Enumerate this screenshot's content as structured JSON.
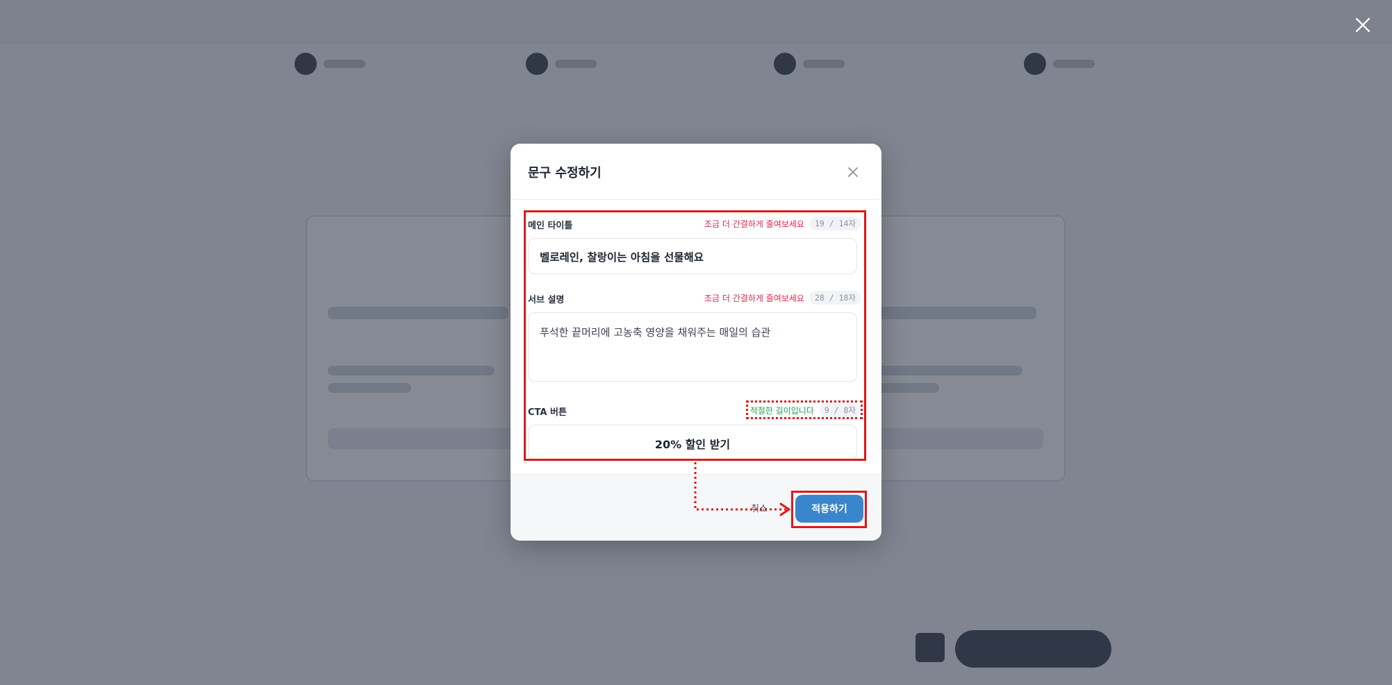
{
  "modal": {
    "title": "문구 수정하기",
    "fields": [
      {
        "label": "메인 타이틀",
        "hint": "조금 더 간결하게 줄여보세요",
        "counter": "19 / 14자",
        "value": "벨로레인, 찰랑이는 아침을 선물해요"
      },
      {
        "label": "서브 설명",
        "hint": "조금 더 간결하게 줄여보세요",
        "counter": "28 / 18자",
        "value": "푸석한 끝머리에 고농축 영양을 채워주는 매일의 습관"
      },
      {
        "label": "CTA 버튼",
        "hint": "적절한 길이입니다",
        "counter": "9 / 8자",
        "value": "20% 할인 받기"
      }
    ],
    "footer": {
      "cancel_label": "취소",
      "apply_label": "적용하기"
    }
  },
  "colors": {
    "hint_warning": "#e2274f",
    "hint_ok": "#1fa34a",
    "apply_button": "#3a86cc",
    "annotation": "#e01818"
  },
  "icons": {
    "modal_close": "close-icon",
    "overlay_close": "close-icon"
  }
}
